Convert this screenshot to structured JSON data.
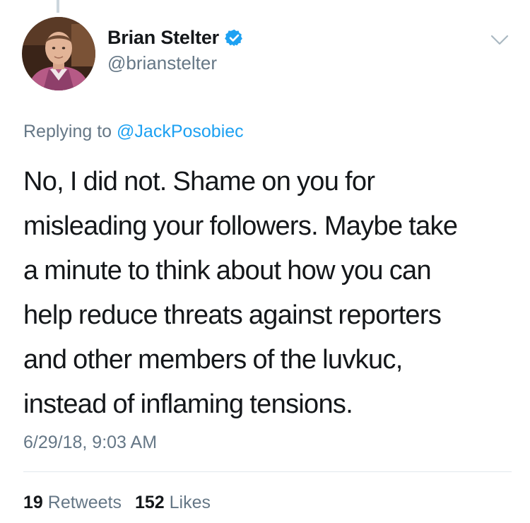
{
  "author": {
    "display_name": "Brian Stelter",
    "handle": "@brianstelter",
    "verified_icon": "verified-badge-icon"
  },
  "reply": {
    "prefix": "Replying to",
    "mention": "@JackPosobiec"
  },
  "tweet": {
    "lines": [
      "No, I did not. Shame on you for",
      "misleading your followers. Maybe take",
      "a minute to think about how you can",
      "help reduce threats against reporters",
      "and other members of the luvkuc,",
      "instead of inflaming tensions."
    ]
  },
  "timestamp": "6/29/18, 9:03 AM",
  "stats": {
    "retweets_count": "19",
    "retweets_label": "Retweets",
    "likes_count": "152",
    "likes_label": "Likes"
  },
  "colors": {
    "text": "#14171a",
    "secondary": "#657786",
    "link": "#1da1f2",
    "verified": "#1da1f2",
    "divider": "#e1e8ed"
  }
}
